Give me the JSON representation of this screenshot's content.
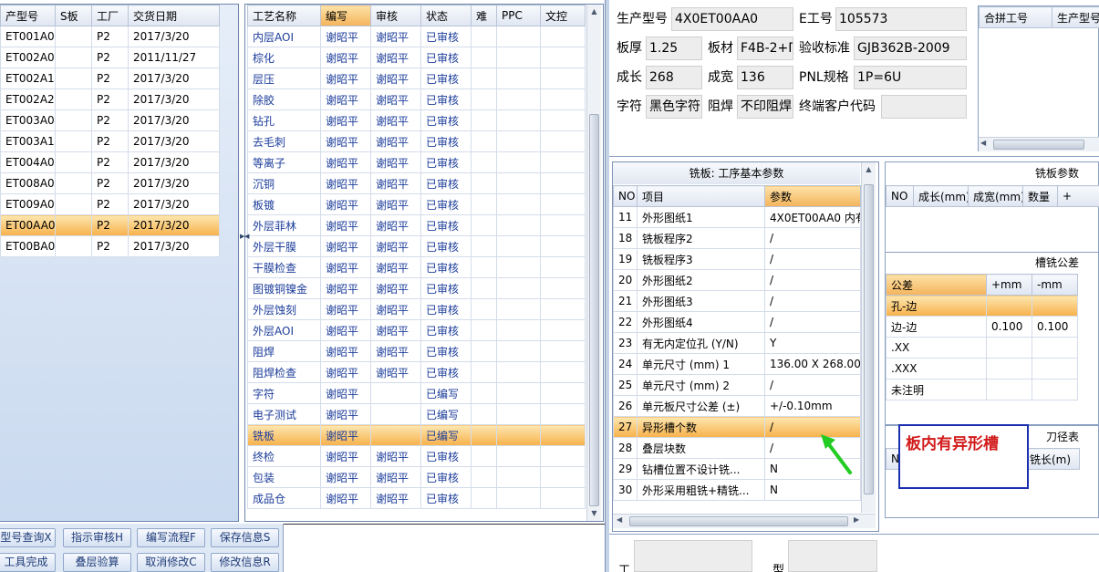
{
  "left_grid": {
    "headers": [
      "产型号",
      "S板",
      "工厂",
      "交货日期"
    ],
    "rows": [
      [
        "ET001A0",
        "",
        "P2",
        "2017/3/20"
      ],
      [
        "ET002A0",
        "",
        "P2",
        "2011/11/27"
      ],
      [
        "ET002A1",
        "",
        "P2",
        "2017/3/20"
      ],
      [
        "ET002A2",
        "",
        "P2",
        "2017/3/20"
      ],
      [
        "ET003A0",
        "",
        "P2",
        "2017/3/20"
      ],
      [
        "ET003A1",
        "",
        "P2",
        "2017/3/20"
      ],
      [
        "ET004A0",
        "",
        "P2",
        "2017/3/20"
      ],
      [
        "ET008A0",
        "",
        "P2",
        "2017/3/20"
      ],
      [
        "ET009A0",
        "",
        "P2",
        "2017/3/20"
      ],
      [
        "ET00AA0",
        "",
        "P2",
        "2017/3/20"
      ],
      [
        "ET00BA0",
        "",
        "P2",
        "2017/3/20"
      ]
    ],
    "selected_index": 9
  },
  "process_grid": {
    "headers": [
      "工艺名称",
      "编写",
      "审核",
      "状态",
      "难",
      "PPC",
      "文控"
    ],
    "rows": [
      [
        "内层AOI",
        "谢昭平",
        "谢昭平",
        "已审核"
      ],
      [
        "棕化",
        "谢昭平",
        "谢昭平",
        "已审核"
      ],
      [
        "层压",
        "谢昭平",
        "谢昭平",
        "已审核"
      ],
      [
        "除胶",
        "谢昭平",
        "谢昭平",
        "已审核"
      ],
      [
        "钻孔",
        "谢昭平",
        "谢昭平",
        "已审核"
      ],
      [
        "去毛刺",
        "谢昭平",
        "谢昭平",
        "已审核"
      ],
      [
        "等离子",
        "谢昭平",
        "谢昭平",
        "已审核"
      ],
      [
        "沉铜",
        "谢昭平",
        "谢昭平",
        "已审核"
      ],
      [
        "板镀",
        "谢昭平",
        "谢昭平",
        "已审核"
      ],
      [
        "外层菲林",
        "谢昭平",
        "谢昭平",
        "已审核"
      ],
      [
        "外层干膜",
        "谢昭平",
        "谢昭平",
        "已审核"
      ],
      [
        "干膜检查",
        "谢昭平",
        "谢昭平",
        "已审核"
      ],
      [
        "图镀铜镍金",
        "谢昭平",
        "谢昭平",
        "已审核"
      ],
      [
        "外层蚀刻",
        "谢昭平",
        "谢昭平",
        "已审核"
      ],
      [
        "外层AOI",
        "谢昭平",
        "谢昭平",
        "已审核"
      ],
      [
        "阻焊",
        "谢昭平",
        "谢昭平",
        "已审核"
      ],
      [
        "阻焊检查",
        "谢昭平",
        "谢昭平",
        "已审核"
      ],
      [
        "字符",
        "谢昭平",
        "",
        "已编写"
      ],
      [
        "电子测试",
        "谢昭平",
        "",
        "已编写"
      ],
      [
        "铣板",
        "谢昭平",
        "",
        "已编写"
      ],
      [
        "终检",
        "谢昭平",
        "谢昭平",
        "已审核"
      ],
      [
        "包装",
        "谢昭平",
        "谢昭平",
        "已审核"
      ],
      [
        "成品仓",
        "谢昭平",
        "谢昭平",
        "已审核"
      ]
    ],
    "selected_index": 19
  },
  "buttons": [
    {
      "label": "型号查询X"
    },
    {
      "label": "指示审核H"
    },
    {
      "label": "编写流程F"
    },
    {
      "label": "保存信息S"
    },
    {
      "label": "工具完成"
    },
    {
      "label": "叠层验算"
    },
    {
      "label": "取消修改C"
    },
    {
      "label": "修改信息R"
    }
  ],
  "info": {
    "model_label": "生产型号",
    "model_value": "4X0ET00AA0",
    "eno_label": "E工号",
    "eno_value": "105573",
    "thickness_label": "板厚",
    "thickness_value": "1.25",
    "material_label": "板材",
    "material_value": "F4B-2+ΠI",
    "standard_label": "验收标准",
    "standard_value": "GJB362B-2009",
    "length_label": "成长",
    "length_value": "268",
    "width_label": "成宽",
    "width_value": "136",
    "pnl_label": "PNL规格",
    "pnl_value": "1P=6U",
    "char_label": "字符",
    "char_value": "黑色字符",
    "mask_label": "阻焊",
    "mask_value": "不印阻焊",
    "customer_label": "终端客户代码",
    "customer_value": ""
  },
  "merge_grid": {
    "headers": [
      "合拼工号",
      "生产型号"
    ]
  },
  "params": {
    "title": "铣板: 工序基本参数",
    "headers": [
      "NO",
      "项目",
      "参数"
    ],
    "rows": [
      [
        "11",
        "外形图纸1",
        "4X0ET00AA0  内有"
      ],
      [
        "18",
        "铣板程序2",
        "/"
      ],
      [
        "19",
        "铣板程序3",
        "/"
      ],
      [
        "20",
        "外形图纸2",
        "/"
      ],
      [
        "21",
        "外形图纸3",
        "/"
      ],
      [
        "22",
        "外形图纸4",
        "/"
      ],
      [
        "23",
        "有无内定位孔 (Y/N)",
        "Y"
      ],
      [
        "24",
        "单元尺寸 (mm) 1",
        "136.00 X 268.00"
      ],
      [
        "25",
        "单元尺寸 (mm) 2",
        "/"
      ],
      [
        "26",
        "单元板尺寸公差 (±)",
        "+/-0.10mm"
      ],
      [
        "27",
        "异形槽个数",
        "/"
      ],
      [
        "28",
        "叠层块数",
        "/"
      ],
      [
        "29",
        "钻槽位置不设计铣...",
        "N"
      ],
      [
        "30",
        "外形采用粗铣+精铣...",
        "N"
      ]
    ],
    "selected_index": 10
  },
  "mill_params": {
    "title": "铣板参数",
    "headers": [
      "NO",
      "成长(mm)",
      "成宽(mm)",
      "数量",
      "+"
    ]
  },
  "tolerance": {
    "title": "槽铣公差",
    "headers": [
      "公差",
      "+mm",
      "-mm"
    ],
    "rows": [
      [
        "孔-边",
        "",
        ""
      ],
      [
        "边-边",
        "0.100",
        "0.100"
      ],
      [
        ".XX",
        "",
        ""
      ],
      [
        ".XXX",
        "",
        ""
      ],
      [
        "未注明",
        "",
        ""
      ]
    ]
  },
  "cutter": {
    "title": "刀径表",
    "headers": [
      "N",
      "铣长(m)"
    ]
  },
  "annotation": {
    "text": "板内有异形槽"
  },
  "bottom": {
    "label1": "工",
    "label2": "型"
  },
  "colors": {
    "annotation_text": "#d11a1a",
    "annotation_border": "#1a2fb0",
    "arrow": "#22cc22",
    "selection": "#f7b14a",
    "link_text": "#1c3d9a"
  }
}
